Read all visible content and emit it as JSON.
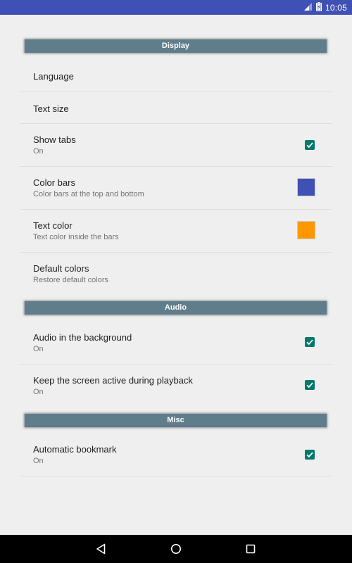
{
  "status_bar": {
    "time": "10:05",
    "icons": [
      "signal-icon",
      "battery-charging-icon"
    ]
  },
  "sections": {
    "display": {
      "header": "Display",
      "items": [
        {
          "title": "Language"
        },
        {
          "title": "Text size"
        },
        {
          "title": "Show tabs",
          "summary": "On",
          "checked": true
        },
        {
          "title": "Color bars",
          "summary": "Color bars at the top and bottom",
          "color": "#3f51b5"
        },
        {
          "title": "Text color",
          "summary": "Text color inside the bars",
          "color": "#ff9800"
        },
        {
          "title": "Default colors",
          "summary": "Restore default colors"
        }
      ]
    },
    "audio": {
      "header": "Audio",
      "items": [
        {
          "title": "Audio in the background",
          "summary": "On",
          "checked": true
        },
        {
          "title": "Keep the screen active during playback",
          "summary": "On",
          "checked": true
        }
      ]
    },
    "misc": {
      "header": "Misc",
      "items": [
        {
          "title": "Automatic bookmark",
          "summary": "On",
          "checked": true
        }
      ]
    }
  },
  "nav_bar": {
    "buttons": [
      "back-icon",
      "home-icon",
      "recents-icon"
    ]
  },
  "colors": {
    "status_bar": "#3f51b5",
    "section_header": "#5f7d8b",
    "checkbox": "#00796b",
    "background": "#efefef"
  }
}
